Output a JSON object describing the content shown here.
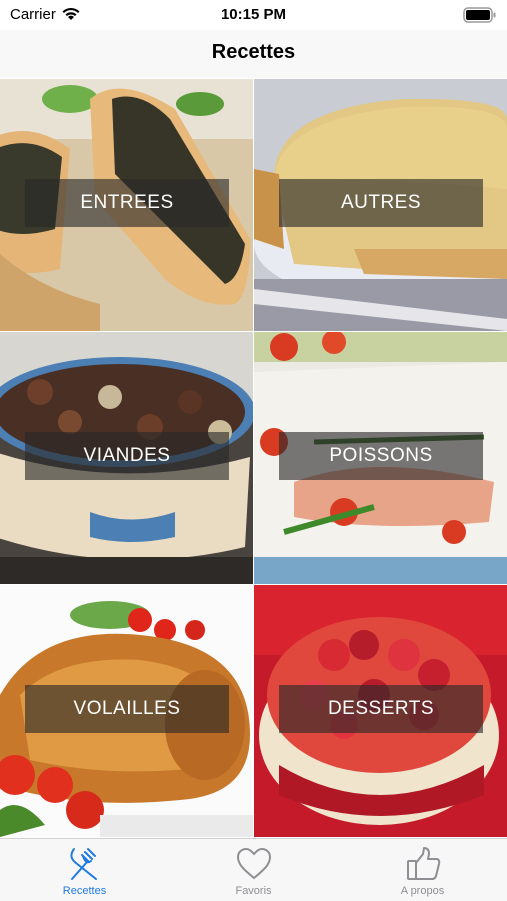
{
  "status_bar": {
    "carrier": "Carrier",
    "time": "10:15 PM"
  },
  "nav": {
    "title": "Recettes"
  },
  "categories": [
    {
      "label": "ENTREES"
    },
    {
      "label": "AUTRES"
    },
    {
      "label": "VIANDES"
    },
    {
      "label": "POISSONS"
    },
    {
      "label": "VOLAILLES"
    },
    {
      "label": "DESSERTS"
    }
  ],
  "tabs": [
    {
      "label": "Recettes",
      "icon": "fork-knife-icon",
      "selected": true
    },
    {
      "label": "Favoris",
      "icon": "heart-icon",
      "selected": false
    },
    {
      "label": "A propos",
      "icon": "thumbs-up-icon",
      "selected": false
    }
  ],
  "colors": {
    "accent": "#1f7ae0",
    "inactive": "#8e8e93"
  }
}
